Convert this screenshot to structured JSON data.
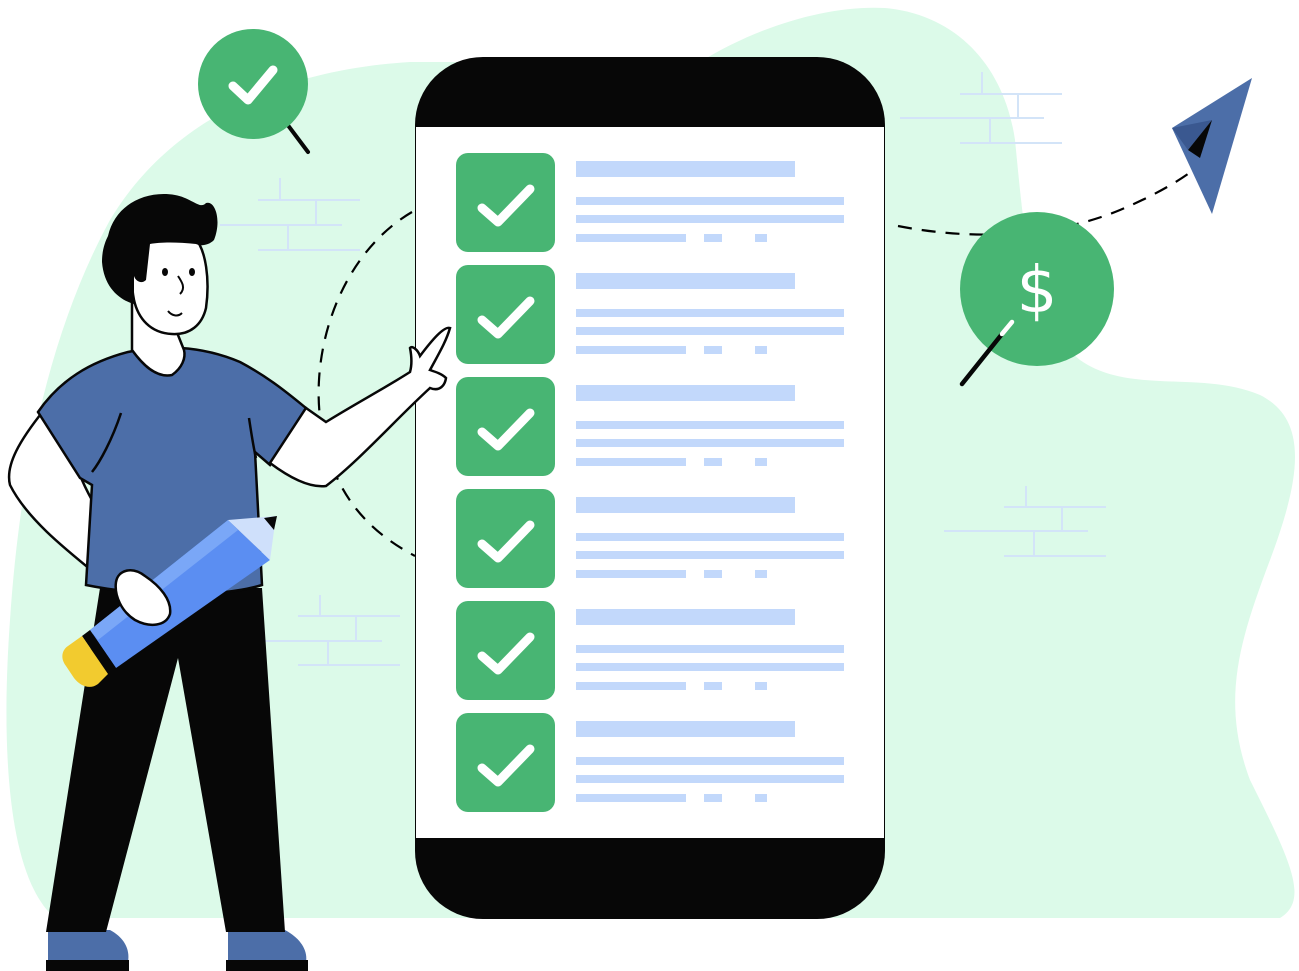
{
  "illustration": {
    "subject": "checklist-on-phone",
    "coin_symbol": "$",
    "checklist_items": [
      {
        "checked": true
      },
      {
        "checked": true
      },
      {
        "checked": true
      },
      {
        "checked": true
      },
      {
        "checked": true
      },
      {
        "checked": true
      }
    ]
  },
  "icons": {
    "check_badge": "check-icon",
    "coin": "dollar-coin-icon",
    "paper_plane": "paper-plane-icon",
    "pencil": "pencil-icon"
  },
  "colors": {
    "background_blob": "#dcfae9",
    "green": "#48b573",
    "phone_frame": "#070707",
    "shirt": "#4c6ea8",
    "pencil_body": "#5b8ef2",
    "pencil_cap": "#f2cb2f",
    "placeholder_lines": "#c2d8fb",
    "brick_lines": "#d3e4f8",
    "plane": "#4c6ea8"
  }
}
